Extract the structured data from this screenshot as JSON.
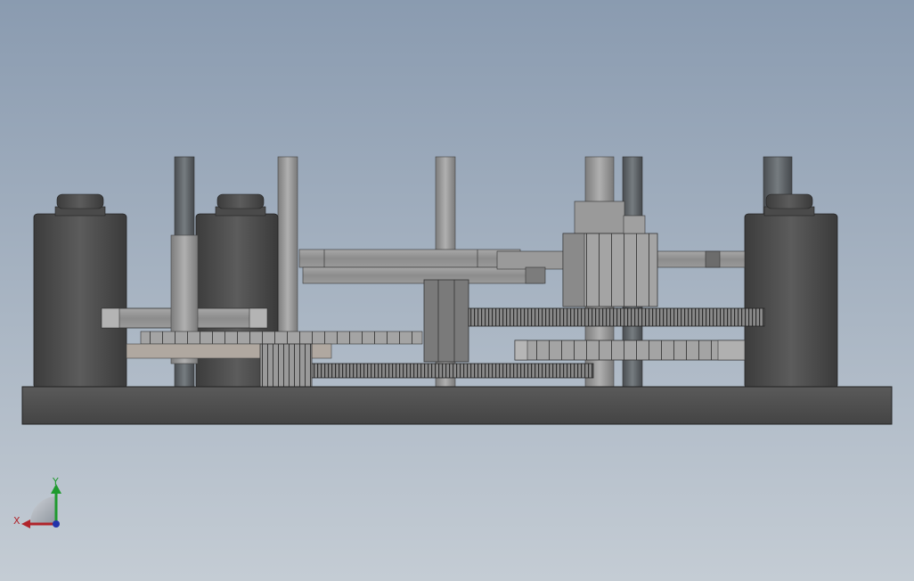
{
  "viewport": {
    "background_top": "#8a9bb0",
    "background_bottom": "#c4ccd4"
  },
  "triad": {
    "x_label": "X",
    "y_label": "Y",
    "x_color": "#b0242b",
    "y_color": "#1f9a2e",
    "z_color": "#2233aa"
  }
}
